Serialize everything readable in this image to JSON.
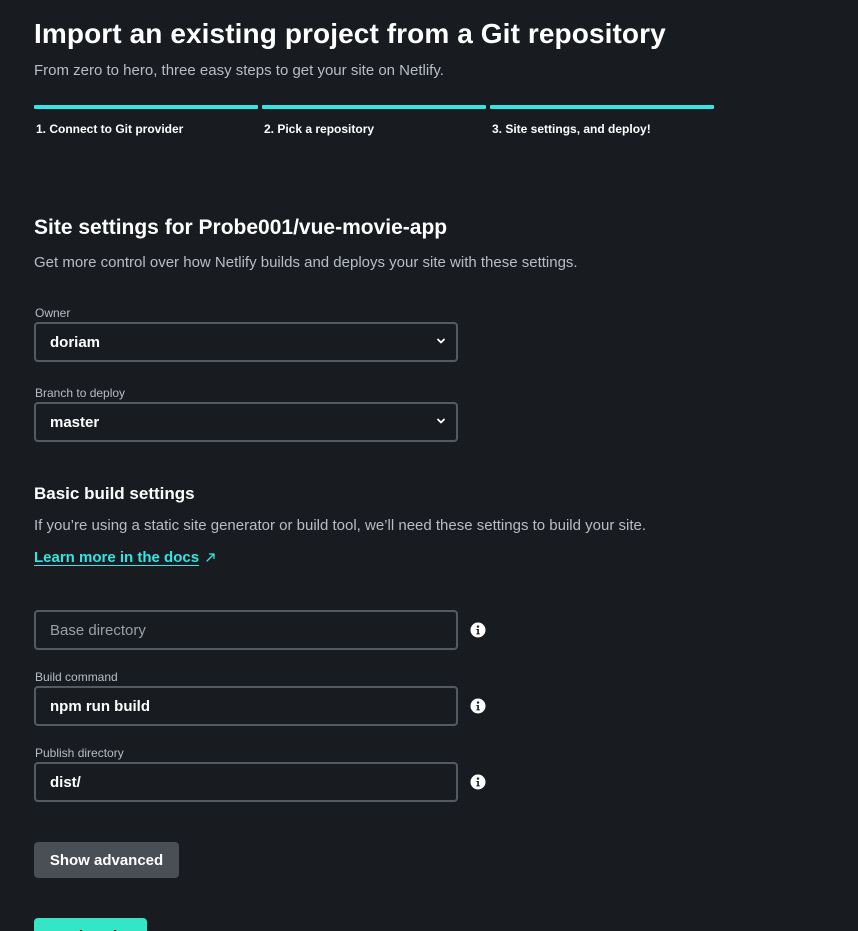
{
  "header": {
    "title": "Import an existing project from a Git repository",
    "subtitle": "From zero to hero, three easy steps to get your site on Netlify."
  },
  "steps": [
    {
      "label": "1. Connect to Git provider"
    },
    {
      "label": "2. Pick a repository"
    },
    {
      "label": "3. Site settings, and deploy!"
    }
  ],
  "site_settings": {
    "title": "Site settings for Probe001/vue-movie-app",
    "description": "Get more control over how Netlify builds and deploys your site with these settings.",
    "owner": {
      "label": "Owner",
      "value": "doriam"
    },
    "branch": {
      "label": "Branch to deploy",
      "value": "master"
    }
  },
  "build_settings": {
    "title": "Basic build settings",
    "description": "If you’re using a static site generator or build tool, we’ll need these settings to build your site.",
    "docs_link": "Learn more in the docs",
    "base_directory": {
      "placeholder": "Base directory",
      "value": ""
    },
    "build_command": {
      "label": "Build command",
      "value": "npm run build"
    },
    "publish_directory": {
      "label": "Publish directory",
      "value": "dist/"
    }
  },
  "buttons": {
    "show_advanced": "Show advanced",
    "deploy": "Deploy site"
  },
  "icons": {
    "select_chevron": "chevron-down-icon",
    "docs_external": "external-link-icon",
    "field_info": "info-icon"
  },
  "colors": {
    "background": "#181b20",
    "accent": "#32e6e2",
    "deploy_button": "#32e6c6",
    "advanced_button": "#4a4f56",
    "muted_text": "#b9bec5",
    "input_border": "#545a61"
  }
}
